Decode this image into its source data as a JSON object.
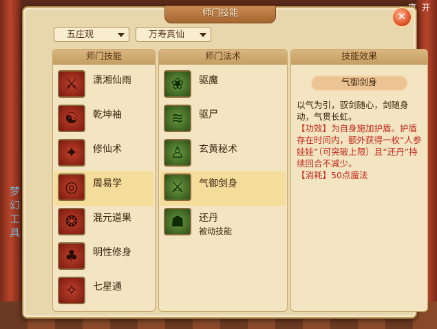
{
  "window": {
    "title": "师门技能"
  },
  "hud": {
    "top_right": "离 开"
  },
  "side_text": "梦幻工具",
  "dropdowns": [
    {
      "value": "五庄观"
    },
    {
      "value": "万寿真仙"
    }
  ],
  "skills_panel": {
    "header": "师门技能",
    "items": [
      {
        "label": "潇湘仙雨",
        "icon": "sword-rain-icon"
      },
      {
        "label": "乾坤袖",
        "icon": "sleeve-icon"
      },
      {
        "label": "修仙术",
        "icon": "crane-icon"
      },
      {
        "label": "周易学",
        "icon": "bagua-icon"
      },
      {
        "label": "混元道果",
        "icon": "fruit-icon"
      },
      {
        "label": "明性修身",
        "icon": "tree-icon"
      },
      {
        "label": "七星通",
        "icon": "constellation-icon"
      }
    ],
    "selected_index": 3
  },
  "spells_panel": {
    "header": "师门法术",
    "items": [
      {
        "label": "驱魔",
        "sub": "",
        "icon": "gourd-icon"
      },
      {
        "label": "驱尸",
        "sub": "",
        "icon": "whip-icon"
      },
      {
        "label": "玄黄秘术",
        "sub": "",
        "icon": "meditation-icon"
      },
      {
        "label": "气御剑身",
        "sub": "",
        "icon": "sword-aura-icon"
      },
      {
        "label": "还丹",
        "sub": "被动技能",
        "icon": "figure-icon"
      }
    ],
    "selected_index": 3
  },
  "effect_panel": {
    "header": "技能效果",
    "skill_name": "气御剑身",
    "description": "以气为引，驭剑随心，剑随身动，气贯长虹。",
    "effect": "【功效】为自身施加护盾。护盾存在时间内，额外获得一枚“人参娃娃”（可突破上限）且“还丹”持续回合不减少。",
    "cost": "【消耗】50点魔法"
  },
  "colors": {
    "accent_red": "#c0281a",
    "selected_row": "#f4dc9a"
  }
}
